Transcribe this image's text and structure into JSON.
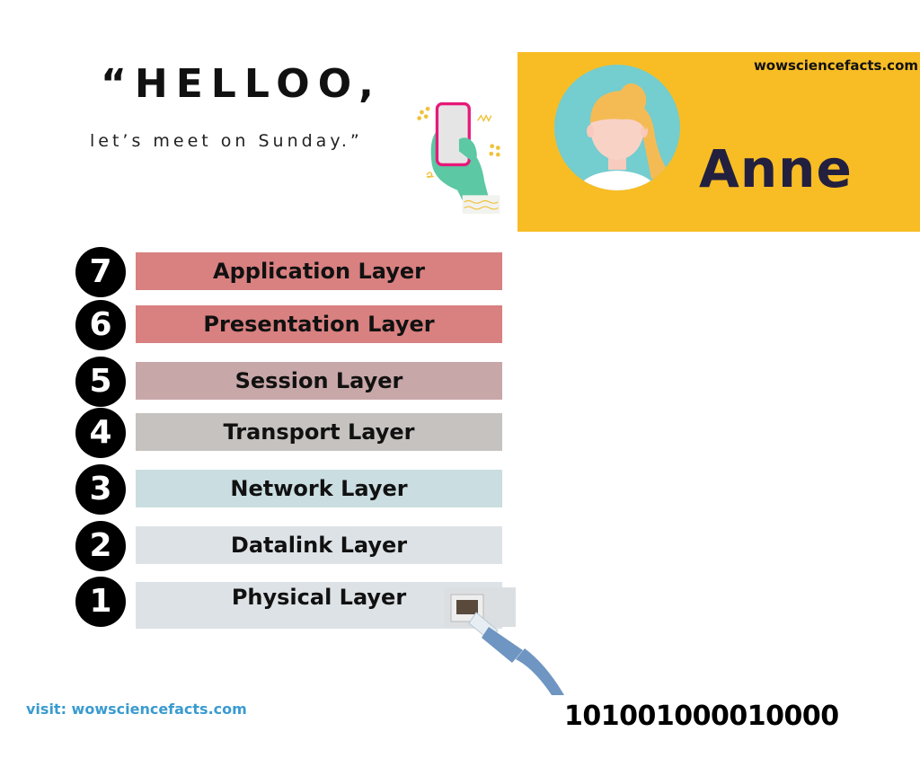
{
  "quote": {
    "greeting": "“HELLOO,",
    "message": "let’s meet on Sunday.”"
  },
  "illustration": {
    "icon": "hand-holding-phone-icon"
  },
  "profile_card": {
    "site": "wowsciencefacts.com",
    "name": "Anne",
    "avatar_icon": "woman-avatar-icon",
    "colors": {
      "background": "#f8bd25",
      "avatar_circle": "#74cdce",
      "name_text": "#23203f"
    }
  },
  "osi_layers": [
    {
      "number": "7",
      "label": "Application Layer",
      "color": "#d98080"
    },
    {
      "number": "6",
      "label": "Presentation Layer",
      "color": "#d98080"
    },
    {
      "number": "5",
      "label": "Session Layer",
      "color": "#c8a7a8"
    },
    {
      "number": "4",
      "label": "Transport Layer",
      "color": "#c5c2bf"
    },
    {
      "number": "3",
      "label": "Network Layer",
      "color": "#cadde1"
    },
    {
      "number": "2",
      "label": "Datalink Layer",
      "color": "#dde2e6"
    },
    {
      "number": "1",
      "label": "Physical Layer",
      "color": "#dde2e6"
    }
  ],
  "cable": {
    "icon": "ethernet-cable-icon"
  },
  "footer": {
    "visit": "visit: wowsciencefacts.com",
    "binary": "101001000010000"
  }
}
